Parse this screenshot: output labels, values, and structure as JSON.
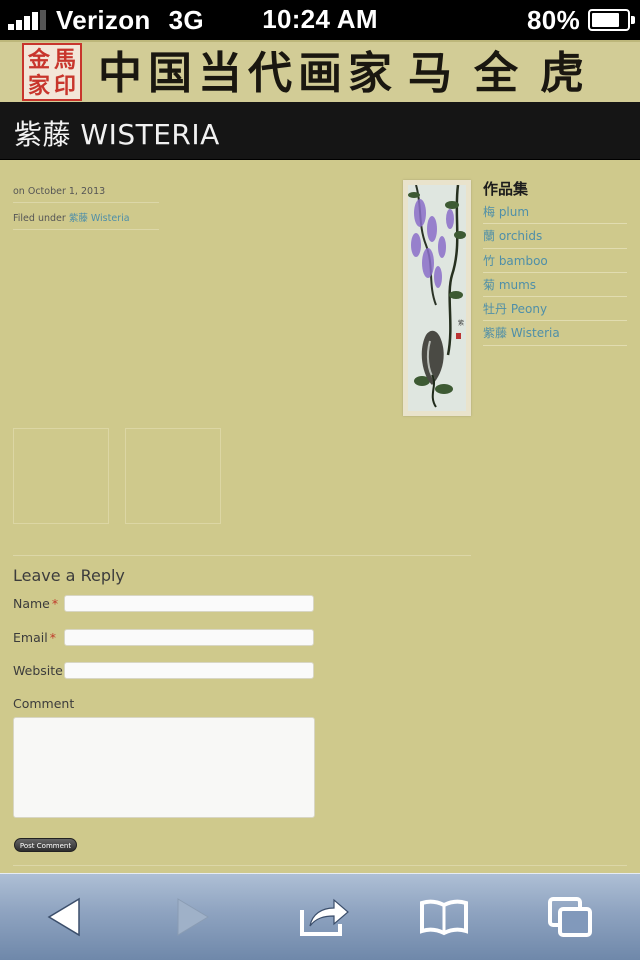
{
  "status_bar": {
    "carrier": "Verizon",
    "network": "3G",
    "time": "10:24 AM",
    "battery": "80%",
    "battery_level": 0.8,
    "signal_bars": 4
  },
  "banner": {
    "seal_chars": [
      "金",
      "馬",
      "家",
      "印"
    ],
    "calligraphy_left": "中国当代画家",
    "calligraphy_right": "马全虎"
  },
  "title": "紫藤 WISTERIA",
  "post_meta": {
    "date_line": "on October 1, 2013",
    "filed_prefix": "Filed under",
    "filed_link": "紫藤 Wisteria"
  },
  "sidebar": {
    "heading": "作品集",
    "items": [
      {
        "label": "梅 plum"
      },
      {
        "label": "蘭 orchids"
      },
      {
        "label": "竹 bamboo"
      },
      {
        "label": "菊 mums"
      },
      {
        "label": "牡丹 Peony"
      },
      {
        "label": "紫藤 Wisteria"
      }
    ]
  },
  "reply_form": {
    "title": "Leave a Reply",
    "name_label": "Name",
    "email_label": "Email",
    "website_label": "Website",
    "comment_label": "Comment",
    "required_mark": "*",
    "submit_label": "Post Comment",
    "name_value": "",
    "email_value": "",
    "website_value": "",
    "comment_value": ""
  },
  "toolbar_icons": [
    "back-arrow-icon",
    "forward-arrow-icon",
    "share-icon",
    "bookmarks-icon",
    "tabs-icon"
  ],
  "colors": {
    "page_bg": "#cfc98c",
    "title_bar": "#151515",
    "link": "#4f8fa8",
    "required": "#c0392b"
  }
}
